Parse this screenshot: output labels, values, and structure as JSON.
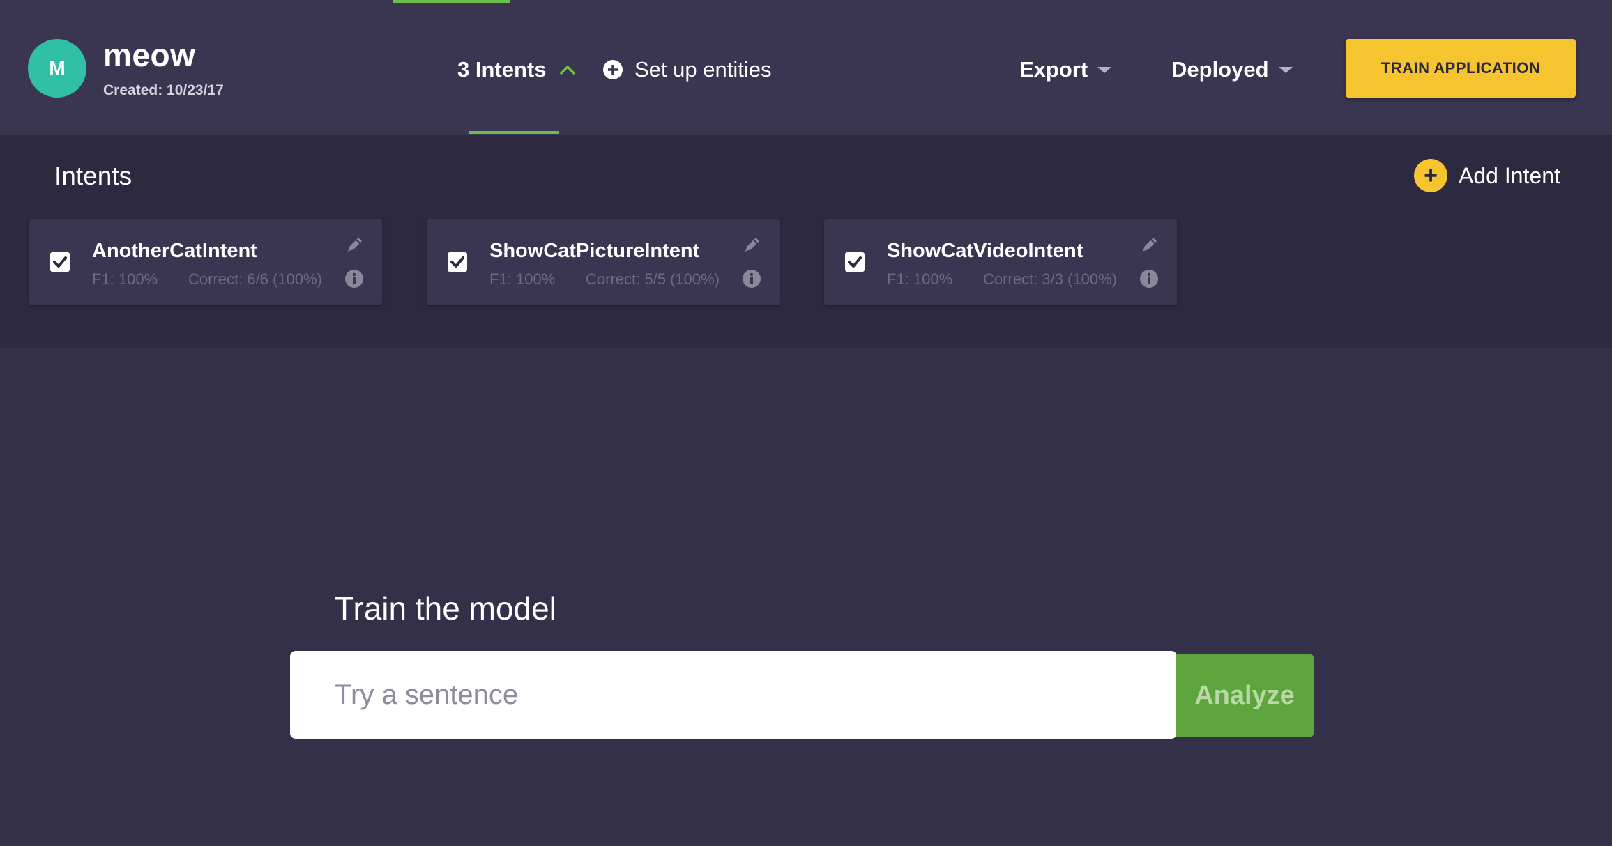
{
  "app": {
    "avatar_letter": "M",
    "name": "meow",
    "created": "Created: 10/23/17"
  },
  "nav": {
    "intents_label": "3 Intents",
    "entities_label": "Set up entities",
    "export_label": "Export",
    "deployed_label": "Deployed",
    "train_button": "TRAIN APPLICATION"
  },
  "intents_panel": {
    "title": "Intents",
    "add_label": "Add Intent",
    "cards": [
      {
        "name": "AnotherCatIntent",
        "f1": "F1: 100%",
        "correct": "Correct: 6/6 (100%)",
        "checked": true
      },
      {
        "name": "ShowCatPictureIntent",
        "f1": "F1: 100%",
        "correct": "Correct: 5/5 (100%)",
        "checked": true
      },
      {
        "name": "ShowCatVideoIntent",
        "f1": "F1: 100%",
        "correct": "Correct: 3/3 (100%)",
        "checked": true
      }
    ]
  },
  "train": {
    "title": "Train the model",
    "placeholder": "Try a sentence",
    "analyze_label": "Analyze"
  },
  "colors": {
    "background": "#35304a",
    "header": "#3a3550",
    "panel": "#2d2940",
    "accent_green": "#6bc04b",
    "accent_yellow": "#f5c42e",
    "avatar": "#2fc0a6"
  }
}
